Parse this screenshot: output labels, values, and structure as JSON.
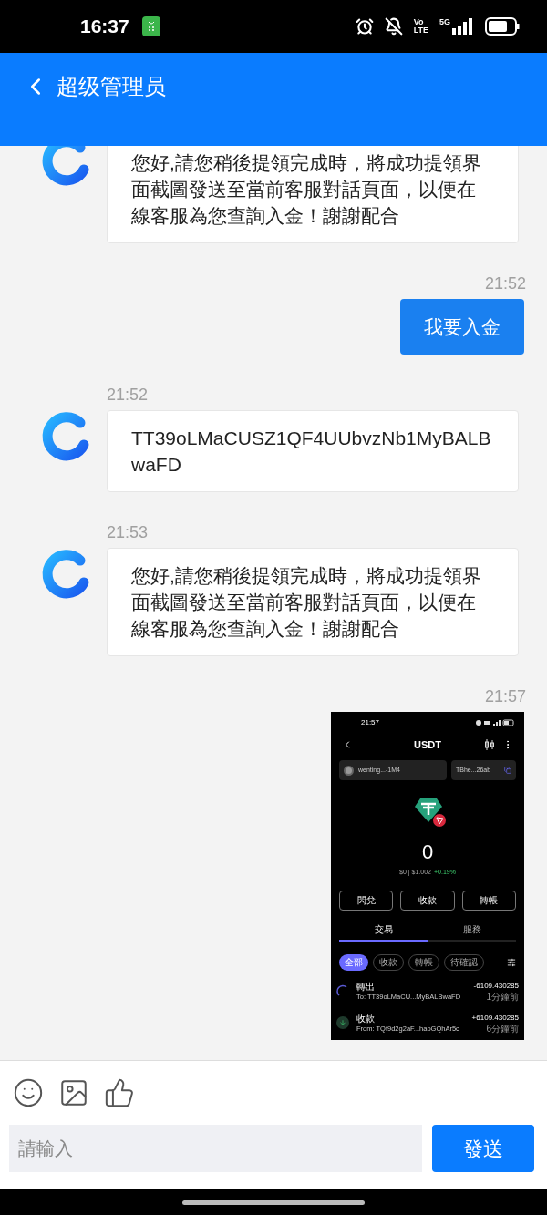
{
  "status_bar": {
    "time": "16:37",
    "network_top": "Vo",
    "network_bottom": "LTE",
    "network_type": "5G"
  },
  "header": {
    "title": "超级管理员"
  },
  "messages": [
    {
      "outgoing": false,
      "kind": "text",
      "text": "您好,請您稍後提領完成時，將成功提領界面截圖發送至當前客服對話頁面，以便在線客服為您查詢入金！謝謝配合"
    },
    {
      "outgoing": true,
      "kind": "text",
      "time": "21:52",
      "text": "我要入金"
    },
    {
      "outgoing": false,
      "kind": "text",
      "time": "21:52",
      "text": "TT39oLMaCUSZ1QF4UUbvzNb1MyBALBwaFD"
    },
    {
      "outgoing": false,
      "kind": "text",
      "time": "21:53",
      "text": "您好,請您稍後提領完成時，將成功提領界面截圖發送至當前客服對話頁面，以便在線客服為您查詢入金！謝謝配合"
    },
    {
      "outgoing": true,
      "kind": "screenshot",
      "time": "21:57",
      "screenshot": {
        "time": "21:57",
        "title": "USDT",
        "account": "wenting...-1M4",
        "address": "TBhe...26ab",
        "balance": "0",
        "price": "$0 | $1.002",
        "change": "+0.19%",
        "actions": [
          "閃兌",
          "收款",
          "轉帳"
        ],
        "tabs": [
          {
            "label": "交易",
            "selected": true
          },
          {
            "label": "服務",
            "selected": false
          }
        ],
        "filters": [
          {
            "label": "全部",
            "selected": true
          },
          {
            "label": "收款",
            "selected": false
          },
          {
            "label": "轉帳",
            "selected": false
          },
          {
            "label": "待確認",
            "selected": false
          }
        ],
        "transactions": [
          {
            "kind": "send",
            "title": "轉出",
            "address": "To: TT39oLMaCU...MyBALBwaFD",
            "amount": "-6109.430285",
            "time": "1分鐘前"
          },
          {
            "kind": "receive",
            "title": "收款",
            "address": "From: TQf9d2g2aF...haoGQhAr5c",
            "amount": "+6109.430285",
            "time": "6分鐘前"
          }
        ]
      }
    }
  ],
  "composer": {
    "placeholder": "請輸入",
    "send": "發送"
  }
}
